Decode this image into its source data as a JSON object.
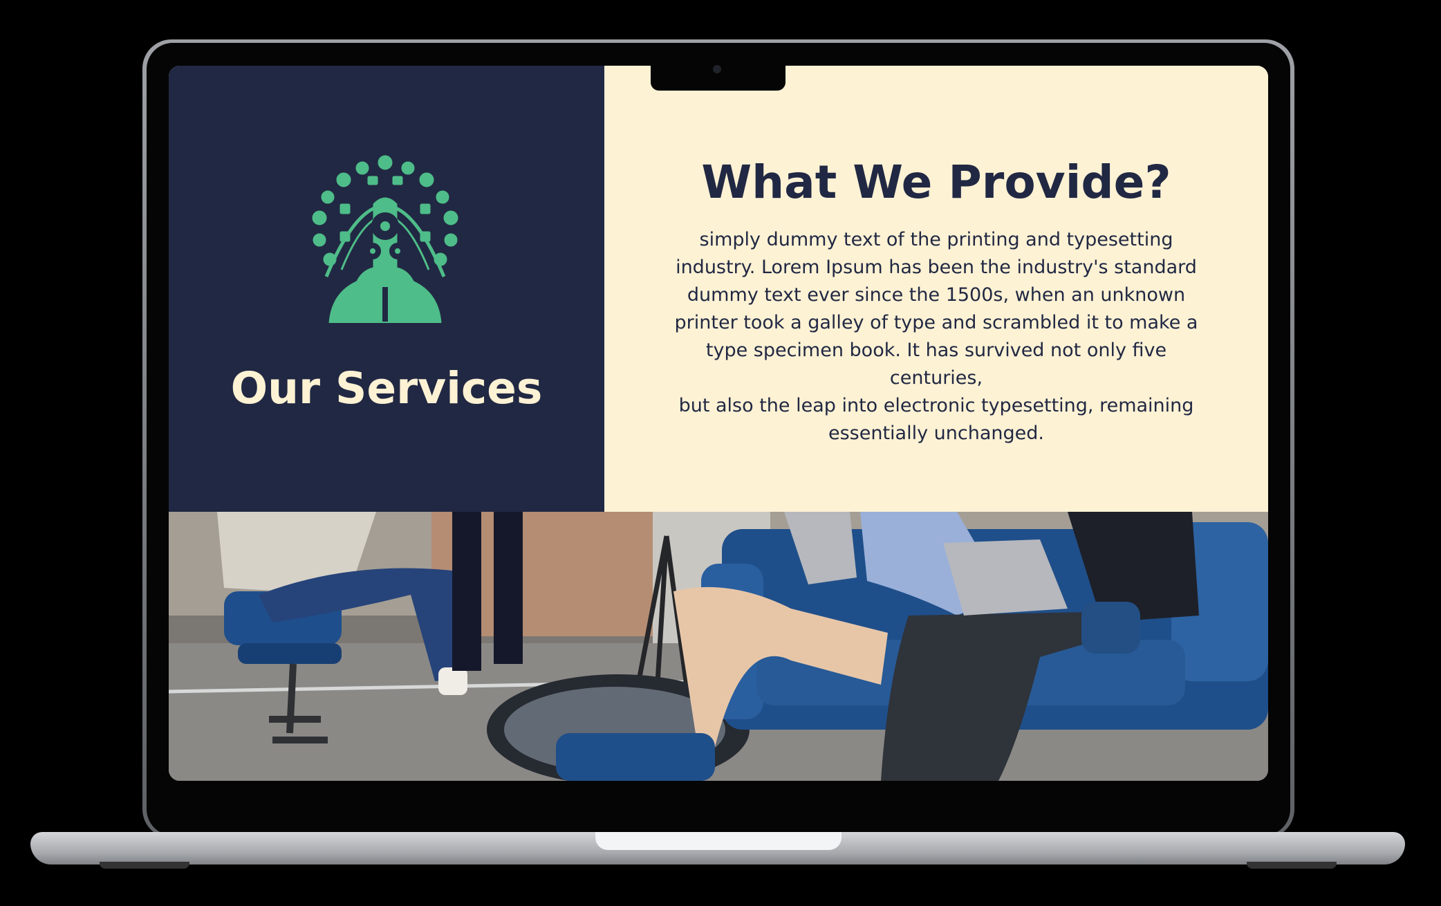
{
  "left": {
    "heading": "Our Services",
    "illustration": "gear-head-icon"
  },
  "right": {
    "heading": "What We Provide?",
    "body_lines": [
      "simply dummy text of the printing and typesetting",
      "industry. Lorem Ipsum has been the industry's standard",
      "dummy text ever since the 1500s, when an unknown",
      "printer took a galley of type and scrambled it to make a",
      "type specimen book. It has survived not only five centuries,",
      "but also the leap into electronic typesetting, remaining",
      "essentially unchanged."
    ]
  },
  "photo": {
    "subject": "team-meeting-photo"
  },
  "colors": {
    "navy": "#212843",
    "cream": "#fdf2d4",
    "accent_green": "#4ebd89"
  }
}
